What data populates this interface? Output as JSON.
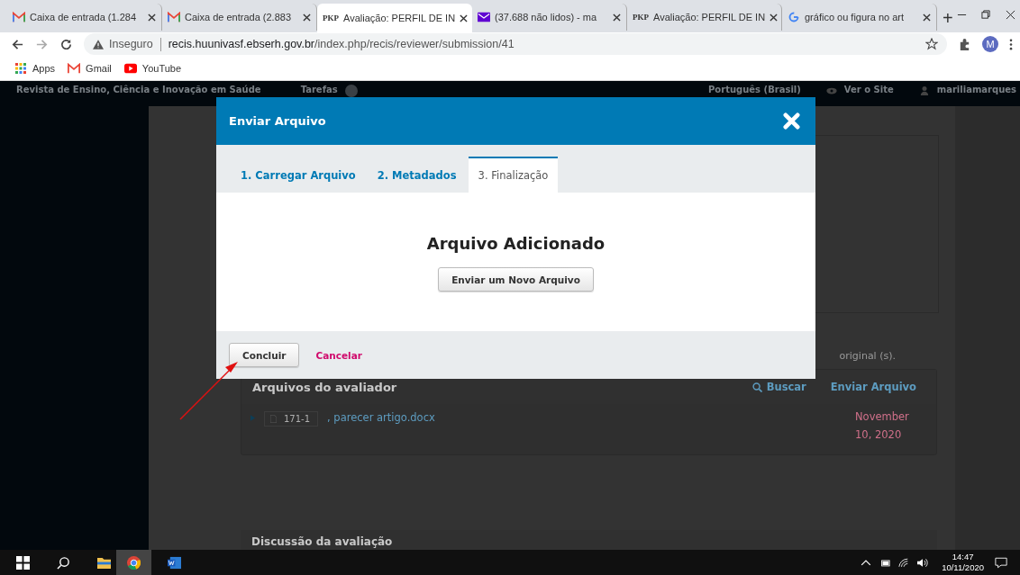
{
  "browser": {
    "tabs": [
      {
        "title": "Caixa de entrada (1.284",
        "kind": "gmail",
        "selected": false
      },
      {
        "title": "Caixa de entrada (2.883",
        "kind": "gmail",
        "selected": false
      },
      {
        "title": "Avaliação: PERFIL DE IN",
        "kind": "pkp",
        "logo": "PKP",
        "selected": true
      },
      {
        "title": "(37.688 não lidos) - ma",
        "kind": "mail",
        "selected": false
      },
      {
        "title": "Avaliação: PERFIL DE IN",
        "kind": "pkp",
        "logo": "PKP",
        "selected": false
      },
      {
        "title": "gráfico ou figura no art",
        "kind": "google",
        "selected": false
      }
    ],
    "new_tab": "+",
    "security": "Inseguro",
    "url_host": "recis.huunivasf.ebserh.gov.br",
    "url_path": "/index.php/recis/reviewer/submission/41",
    "profile_initial": "M",
    "bookmarks": [
      {
        "label": "Apps",
        "kind": "apps"
      },
      {
        "label": "Gmail",
        "kind": "gmail"
      },
      {
        "label": "YouTube",
        "kind": "youtube"
      }
    ]
  },
  "site_header": {
    "site_title": "Revista de Ensino, Ciência e Inovação em Saúde",
    "tasks": "Tarefas",
    "language": "Português (Brasil)",
    "view_site": "Ver o Site",
    "user": "mariliamarques"
  },
  "background": {
    "note": "original (s).",
    "files_title": "Arquivos do avaliador",
    "search_link": "Buscar",
    "upload_link": "Enviar Arquivo",
    "file": {
      "id": "171-1",
      "name": ", parecer artigo.docx",
      "date": "November 10, 2020",
      "expanded": false
    },
    "discussion_title": "Discussão da avaliação"
  },
  "modal": {
    "title": "Enviar Arquivo",
    "steps": [
      {
        "label": "1. Carregar Arquivo",
        "selected": false
      },
      {
        "label": "2. Metadados",
        "selected": false
      },
      {
        "label": "3. Finalização",
        "selected": true
      }
    ],
    "heading": "Arquivo Adicionado",
    "new_file_button": "Enviar um Novo Arquivo",
    "done_button": "Concluir",
    "cancel_link": "Cancelar"
  },
  "taskbar": {
    "time": "14:47",
    "date": "10/11/2020"
  }
}
